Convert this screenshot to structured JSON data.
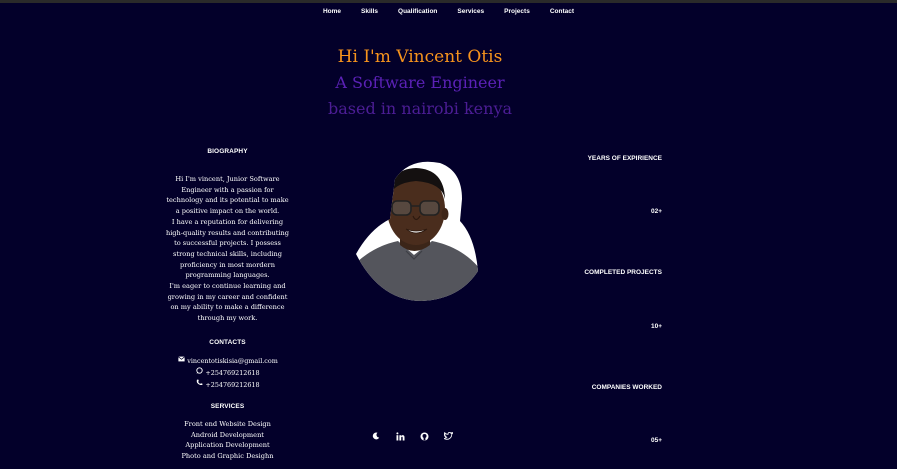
{
  "nav": {
    "items": [
      "Home",
      "Skills",
      "Qualification",
      "Services",
      "Projects",
      "Contact"
    ]
  },
  "hero": {
    "greeting": "Hi I'm Vincent Otis",
    "role": "A Software Engineer",
    "location": "based in nairobi kenya"
  },
  "biography": {
    "title": "BIOGRAPHY",
    "text": "Hi I'm vincent, Junior Software\nEngineer with a passion for\ntechnology and its potential to make\na positive impact on the world.\nI have a reputation for delivering\nhigh-quality results and contributing\nto successful projects. I possess\nstrong technical skills, including\nproficiency in most mordern\nprogramming languages.\nI'm eager to continue learning and\ngrowing in my career and confident\non my ability to make a difference\nthrough my work."
  },
  "contacts": {
    "title": "CONTACTS",
    "email": "vincentotiskisia@gmail.com",
    "whatsapp": "+254769212618",
    "phone": "+254769212618"
  },
  "services": {
    "title": "SERVICES",
    "items": [
      "Front end Website Design",
      "Android Development",
      "Application Development",
      "Photo and Graphic Desighn"
    ]
  },
  "stats": [
    {
      "label": "YEARS OF EXPIRIENCE",
      "value": "02+"
    },
    {
      "label": "COMPLETED PROJECTS",
      "value": "10+"
    },
    {
      "label": "COMPANIES WORKED",
      "value": "05+"
    }
  ],
  "socials": [
    "moon-icon",
    "linkedin-icon",
    "github-icon",
    "twitter-icon"
  ],
  "colors": {
    "background": "#03002a",
    "greeting": "#f7941d",
    "role": "#5b21b6"
  }
}
